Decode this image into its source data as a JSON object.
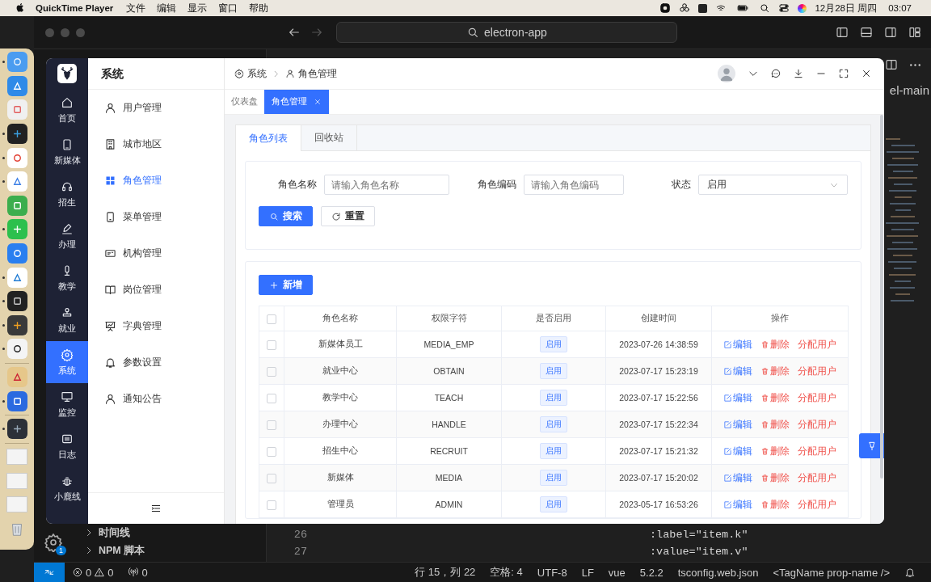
{
  "menu_bar": {
    "app_name": "QuickTime Player",
    "menus": [
      "文件",
      "编辑",
      "显示",
      "窗口",
      "帮助"
    ],
    "date": "12月28日 周四",
    "time": "03:07"
  },
  "dock": {
    "apps": [
      {
        "running": true
      },
      {
        "running": false
      },
      {
        "running": false
      },
      {
        "running": true
      },
      {
        "running": true
      },
      {
        "running": true
      },
      {
        "running": false
      },
      {
        "running": true
      },
      {
        "running": false
      },
      {
        "running": true
      },
      {
        "running": true
      },
      {
        "running": true
      },
      {
        "running": true
      },
      {
        "running": false
      },
      {
        "running": true
      },
      {
        "running": true
      }
    ]
  },
  "editor": {
    "search": "electron-app",
    "breadcrumb": "el-main",
    "sidebar_sections": [
      {
        "label": "时间线",
        "expanded": false
      },
      {
        "label": "NPM 脚本",
        "expanded": false
      }
    ],
    "settings_badge": "1",
    "code_lines": [
      {
        "number": "26",
        "code": ":label=\"item.k\""
      },
      {
        "number": "27",
        "code": ":value=\"item.v\""
      }
    ],
    "status_bar": {
      "errors": "0",
      "warnings": "0",
      "ports": "0",
      "items": [
        "行 15，列 22",
        "空格: 4",
        "UTF-8",
        "LF",
        "vue",
        "5.2.2",
        "tsconfig.web.json",
        "<TagName prop-name />"
      ]
    }
  },
  "app": {
    "nav_rail": [
      {
        "label": "首页",
        "selected": false
      },
      {
        "label": "新媒体",
        "selected": false
      },
      {
        "label": "招生",
        "selected": false
      },
      {
        "label": "办理",
        "selected": false
      },
      {
        "label": "教学",
        "selected": false
      },
      {
        "label": "就业",
        "selected": false
      },
      {
        "label": "系统",
        "selected": true
      },
      {
        "label": "监控",
        "selected": false
      },
      {
        "label": "日志",
        "selected": false
      },
      {
        "label": "小鹿线",
        "selected": false
      }
    ],
    "submenu": {
      "title": "系统",
      "items": [
        {
          "label": "用户管理",
          "selected": false
        },
        {
          "label": "城市地区",
          "selected": false
        },
        {
          "label": "角色管理",
          "selected": true
        },
        {
          "label": "菜单管理",
          "selected": false
        },
        {
          "label": "机构管理",
          "selected": false
        },
        {
          "label": "岗位管理",
          "selected": false
        },
        {
          "label": "字典管理",
          "selected": false
        },
        {
          "label": "参数设置",
          "selected": false
        },
        {
          "label": "通知公告",
          "selected": false
        }
      ]
    },
    "breadcrumb": [
      "系统",
      "角色管理"
    ],
    "tags": [
      {
        "label": "仪表盘",
        "selected": false,
        "closable": false
      },
      {
        "label": "角色管理",
        "selected": true,
        "closable": true
      }
    ],
    "tabs": [
      {
        "label": "角色列表",
        "selected": true
      },
      {
        "label": "回收站",
        "selected": false
      }
    ],
    "filters": [
      {
        "kind": "input",
        "label": "角色名称",
        "placeholder": "请输入角色名称"
      },
      {
        "kind": "input",
        "label": "角色编码",
        "placeholder": "请输入角色编码"
      },
      {
        "kind": "select",
        "label": "状态",
        "value": "启用"
      }
    ],
    "form_buttons": [
      {
        "kind": "primary",
        "label": "搜索"
      },
      {
        "kind": "default",
        "label": "重置"
      }
    ],
    "add_button": "新增",
    "table": {
      "all_checked": false,
      "columns": [
        "角色名称",
        "权限字符",
        "是否启用",
        "创建时间",
        "操作"
      ],
      "rows": [
        {
          "checked": false,
          "name": "新媒体员工",
          "key": "MEDIA_EMP",
          "status": "启用",
          "created": "2023-07-26 14:38:59",
          "actions": [
            "编辑",
            "删除",
            "分配用户"
          ]
        },
        {
          "checked": false,
          "name": "就业中心",
          "key": "OBTAIN",
          "status": "启用",
          "created": "2023-07-17 15:23:19",
          "actions": [
            "编辑",
            "删除",
            "分配用户"
          ]
        },
        {
          "checked": false,
          "name": "教学中心",
          "key": "TEACH",
          "status": "启用",
          "created": "2023-07-17 15:22:56",
          "actions": [
            "编辑",
            "删除",
            "分配用户"
          ]
        },
        {
          "checked": false,
          "name": "办理中心",
          "key": "HANDLE",
          "status": "启用",
          "created": "2023-07-17 15:22:34",
          "actions": [
            "编辑",
            "删除",
            "分配用户"
          ]
        },
        {
          "checked": false,
          "name": "招生中心",
          "key": "RECRUIT",
          "status": "启用",
          "created": "2023-07-17 15:21:32",
          "actions": [
            "编辑",
            "删除",
            "分配用户"
          ]
        },
        {
          "checked": false,
          "name": "新媒体",
          "key": "MEDIA",
          "status": "启用",
          "created": "2023-07-17 15:20:02",
          "actions": [
            "编辑",
            "删除",
            "分配用户"
          ]
        },
        {
          "checked": false,
          "name": "管理员",
          "key": "ADMIN",
          "status": "启用",
          "created": "2023-05-17 16:53:26",
          "actions": [
            "编辑",
            "删除",
            "分配用户"
          ]
        }
      ]
    }
  }
}
